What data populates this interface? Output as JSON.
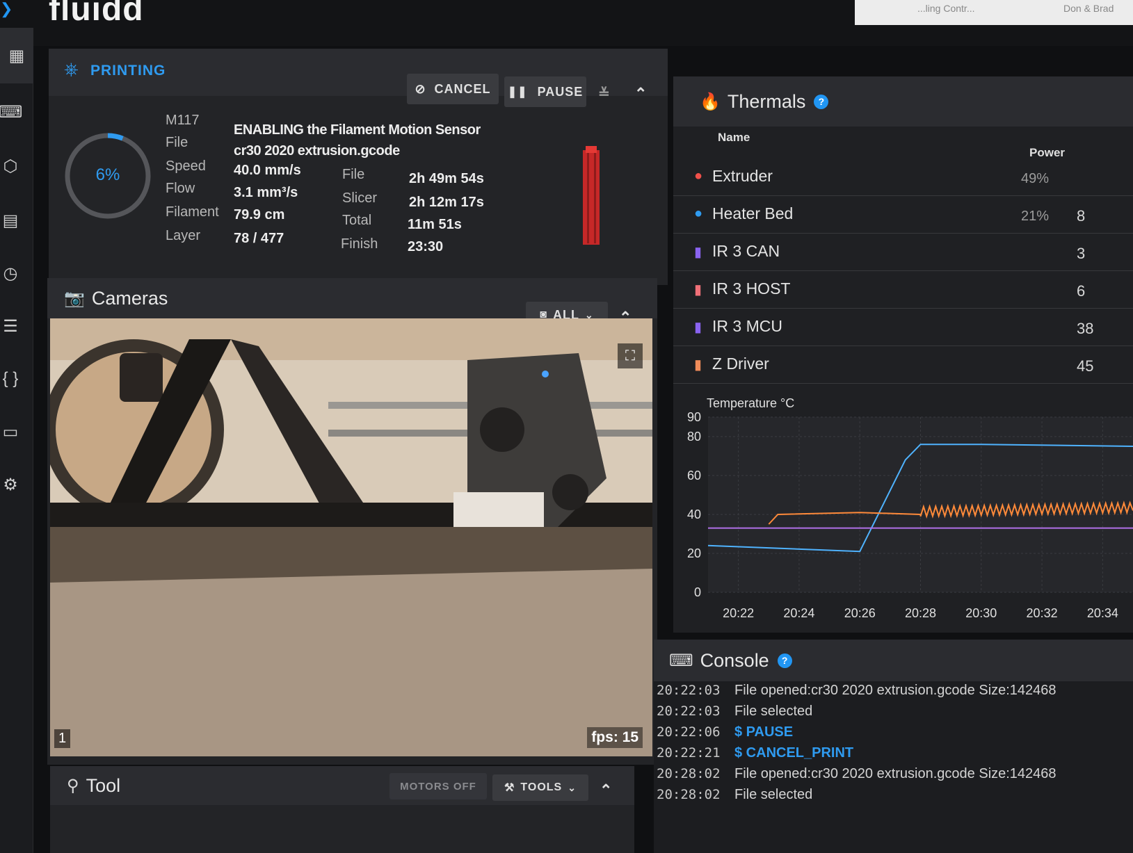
{
  "app": {
    "logo": "fluidd",
    "top_strip_left": "...ling Contr...",
    "top_strip_right": "Don & Brad"
  },
  "printing": {
    "title": "PRINTING",
    "cancel_label": "CANCEL",
    "pause_label": "PAUSE",
    "progress_text": "6%",
    "progress_fraction": 0.06,
    "m117_label": "M117",
    "m117_value": "ENABLING the Filament Motion Sensor",
    "file_label": "File",
    "file_value": "cr30 2020 extrusion.gcode",
    "speed_label": "Speed",
    "speed_value": "40.0 mm/s",
    "flow_label": "Flow",
    "flow_value": "3.1 mm³/s",
    "filament_label": "Filament",
    "filament_value": "79.9 cm",
    "layer_label": "Layer",
    "layer_value": "78 / 477",
    "est_file_label": "File",
    "est_file_value": "2h 49m 54s",
    "slicer_label": "Slicer",
    "slicer_value": "2h 12m 17s",
    "total_label": "Total",
    "total_value": "11m 51s",
    "finish_label": "Finish",
    "finish_value": "23:30"
  },
  "cameras": {
    "title": "Cameras",
    "filter_label": "ALL",
    "fps": "fps: 15",
    "camera_number": "1"
  },
  "tool": {
    "title": "Tool",
    "motors_off_label": "MOTORS OFF",
    "tools_label": "TOOLS"
  },
  "thermals": {
    "title": "Thermals",
    "help": "?",
    "col_name": "Name",
    "col_power": "Power",
    "sensors": [
      {
        "name": "Extruder",
        "power": "49%",
        "cut": "",
        "icon": "flame-icon",
        "color": "#f0504a"
      },
      {
        "name": "Heater Bed",
        "power": "21%",
        "cut": "8",
        "icon": "flame-icon",
        "color": "#2f9bf0"
      },
      {
        "name": "IR 3 CAN",
        "power": "",
        "cut": "3",
        "icon": "thermometer-icon",
        "color": "#8a63f0"
      },
      {
        "name": "IR 3 HOST",
        "power": "",
        "cut": "6",
        "icon": "thermometer-icon",
        "color": "#f07078"
      },
      {
        "name": "IR 3 MCU",
        "power": "",
        "cut": "38",
        "icon": "thermometer-icon",
        "color": "#8a63f0"
      },
      {
        "name": "Z Driver",
        "power": "",
        "cut": "45",
        "icon": "thermometer-icon",
        "color": "#f08c5a"
      }
    ]
  },
  "chart_data": {
    "type": "line",
    "title": "Temperature °C",
    "ylim": [
      0,
      90
    ],
    "yticks": [
      0,
      20,
      40,
      60,
      80,
      90
    ],
    "xticks": [
      "20:22",
      "20:24",
      "20:26",
      "20:28",
      "20:30",
      "20:32",
      "20:34"
    ],
    "x_range": [
      "20:21",
      "20:35"
    ],
    "grid": true,
    "series": [
      {
        "color": "#4fb3ff",
        "x": [
          "20:21",
          "20:26",
          "20:27.5",
          "20:28",
          "20:30",
          "20:35"
        ],
        "values": [
          24,
          21,
          68,
          76,
          76,
          75
        ]
      },
      {
        "color": "#ff8a3a",
        "x": [
          "20:23",
          "20:23.3",
          "20:26",
          "20:28",
          "20:35"
        ],
        "values": [
          35,
          40,
          41,
          40,
          42
        ],
        "noisy_after": "20:28"
      },
      {
        "color": "#b070e8",
        "x": [
          "20:21",
          "20:35"
        ],
        "values": [
          33,
          33
        ]
      }
    ]
  },
  "console": {
    "title": "Console",
    "help": "?",
    "lines": [
      {
        "time": "20:22:03",
        "msg": "File opened:cr30 2020 extrusion.gcode Size:142468",
        "cmd": false
      },
      {
        "time": "20:22:03",
        "msg": "File selected",
        "cmd": false
      },
      {
        "time": "20:22:06",
        "msg": "$ PAUSE",
        "cmd": true
      },
      {
        "time": "20:22:21",
        "msg": "$ CANCEL_PRINT",
        "cmd": true
      },
      {
        "time": "20:28:02",
        "msg": "File opened:cr30 2020 extrusion.gcode Size:142468",
        "cmd": false
      },
      {
        "time": "20:28:02",
        "msg": "File selected",
        "cmd": false
      }
    ]
  }
}
